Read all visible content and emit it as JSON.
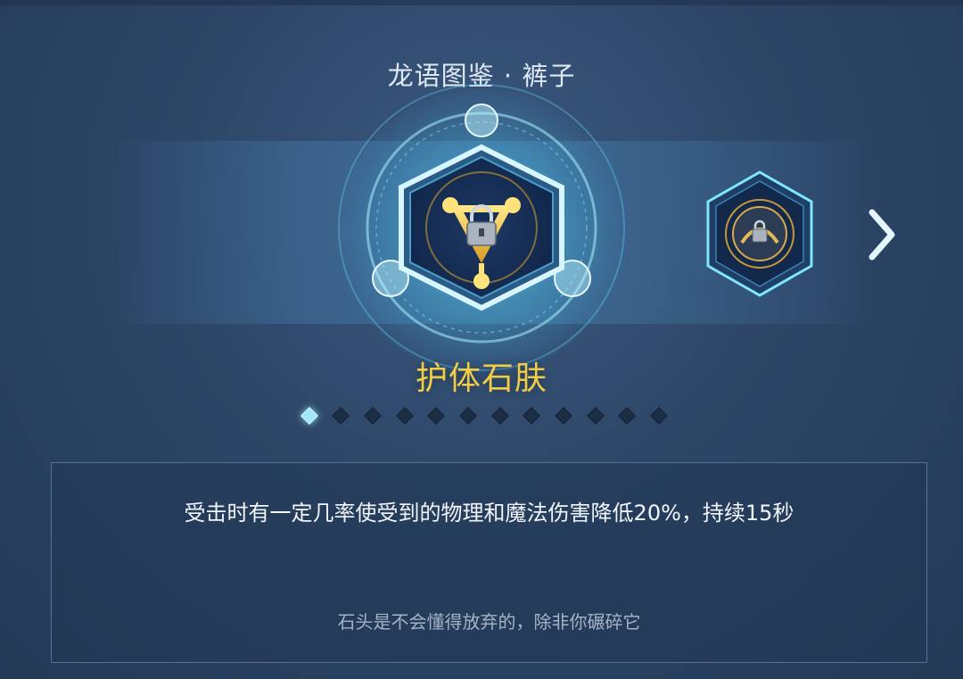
{
  "title": "龙语图鉴 · 裤子",
  "skill": {
    "name": "护体石肤",
    "description": "受击时有一定几率使受到的物理和魔法伤害降低20%，持续15秒",
    "flavor": "石头是不会懂得放弃的，除非你碾碎它",
    "locked": true
  },
  "pagination": {
    "total": 12,
    "current": 1
  },
  "colors": {
    "skill_name": "#f1cd47",
    "glow": "#7fe3ff",
    "background": "#2d4667"
  },
  "icons": {
    "current_item": "triangle-rune-lock-icon",
    "next_item": "dragon-orb-lock-icon",
    "next": "chevron-right-icon"
  }
}
